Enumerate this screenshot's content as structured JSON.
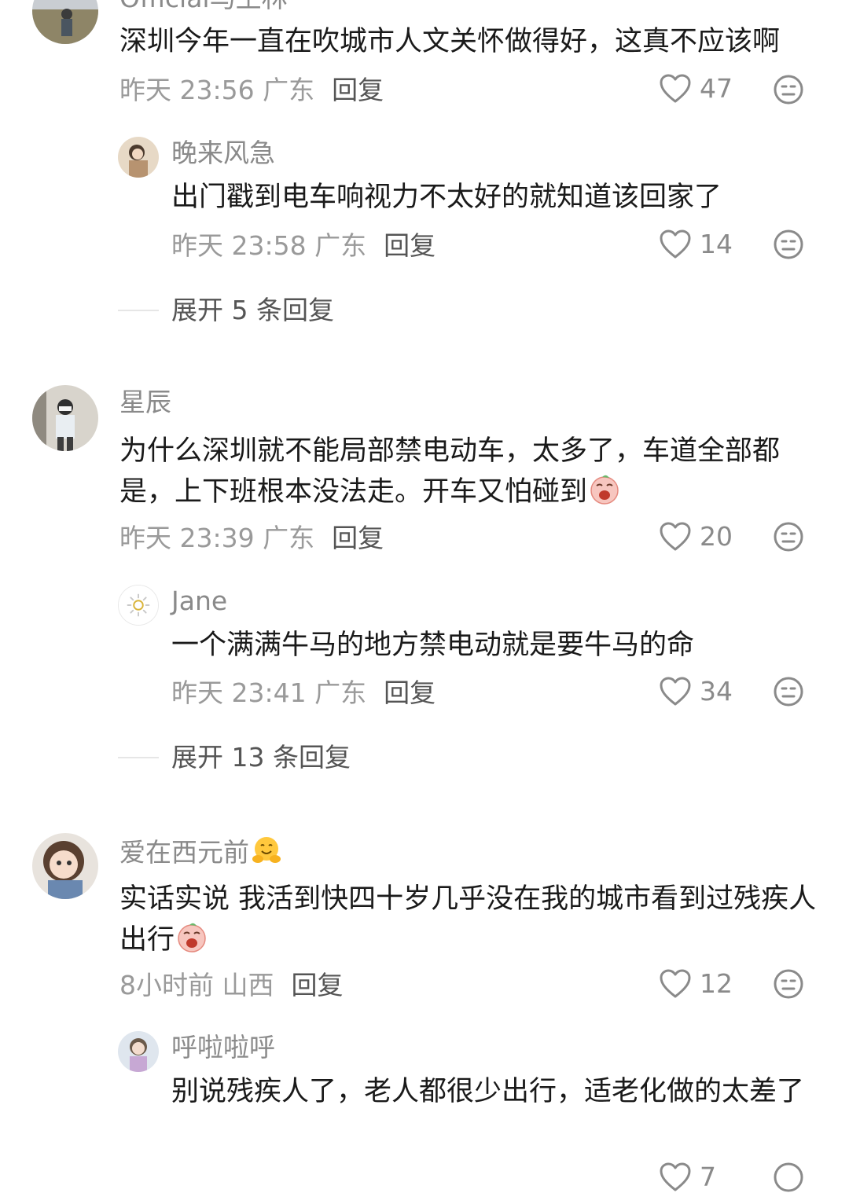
{
  "comments": [
    {
      "user": "Official马王林",
      "text": "深圳今年一直在吹城市人文关怀做得好，这真不应该啊",
      "time": "昨天 23:56 广东",
      "reply_label": "回复",
      "likes": "47",
      "replies": [
        {
          "user": "晚来风急",
          "text": "出门戳到电车响视力不太好的就知道该回家了",
          "time": "昨天 23:58 广东",
          "reply_label": "回复",
          "likes": "14"
        }
      ],
      "expand": "展开 5 条回复"
    },
    {
      "user": "星辰",
      "text": "为什么深圳就不能局部禁电动车，太多了，车道全部都是，上下班根本没法走。开车又怕碰到",
      "time": "昨天 23:39 广东",
      "reply_label": "回复",
      "likes": "20",
      "replies": [
        {
          "user": "Jane",
          "text": "一个满满牛马的地方禁电动就是要牛马的命",
          "time": "昨天 23:41 广东",
          "reply_label": "回复",
          "likes": "34"
        }
      ],
      "expand": "展开 13 条回复"
    },
    {
      "user": "爱在西元前",
      "text": "实话实说 我活到快四十岁几乎没在我的城市看到过残疾人出行",
      "time": "8小时前 山西",
      "reply_label": "回复",
      "likes": "12",
      "replies": [
        {
          "user": "呼啦啦呼",
          "text": "别说残疾人了，老人都很少出行，适老化做的太差了",
          "time": "",
          "reply_label": "",
          "likes": "7"
        }
      ]
    }
  ],
  "icons": {
    "like": "heart-outline-icon",
    "dislike": "neutral-face-icon",
    "emoji_crying": "crying-face-emoji",
    "emoji_hug": "hugging-face-emoji"
  },
  "colors": {
    "username": "#8a8a8a",
    "meta": "#9a9a9a",
    "text": "#1a1a1a"
  }
}
